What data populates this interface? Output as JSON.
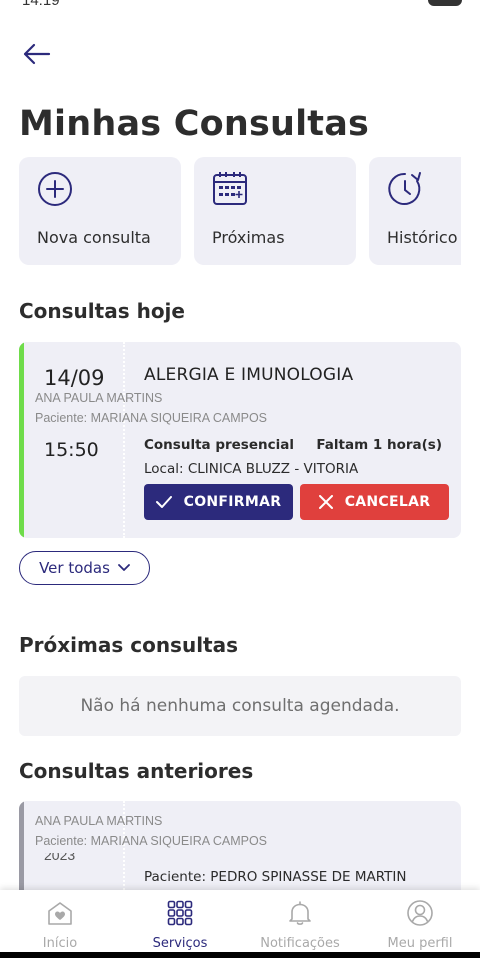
{
  "status_bar": {
    "time": "14:19",
    "battery": "85"
  },
  "header": {
    "title": "Minhas Consultas"
  },
  "quick_actions": [
    {
      "label": "Nova consulta",
      "icon": "plus-circle-icon"
    },
    {
      "label": "Próximas",
      "icon": "calendar-icon"
    },
    {
      "label": "Histórico",
      "icon": "history-clock-icon"
    }
  ],
  "today": {
    "section_title": "Consultas hoje",
    "appointment": {
      "date": "14/09",
      "specialty": "ALERGIA E IMUNOLOGIA",
      "doctor": "ANA PAULA MARTINS",
      "patient": "Paciente: MARIANA SIQUEIRA CAMPOS",
      "time": "15:50",
      "type": "Consulta presencial",
      "remaining": "Faltam 1 hora(s)",
      "location": "Local: CLINICA BLUZZ - VITORIA",
      "confirm_label": "CONFIRMAR",
      "cancel_label": "CANCELAR",
      "accent_color": "#6fdc4a"
    },
    "see_all_label": "Ver todas"
  },
  "upcoming": {
    "section_title": "Próximas consultas",
    "empty_message": "Não há nenhuma consulta agendada."
  },
  "previous": {
    "section_title": "Consultas anteriores",
    "appointment": {
      "doctor": "ANA PAULA MARTINS",
      "patient": "Paciente: MARIANA SIQUEIRA CAMPOS",
      "year": "2023",
      "patient_secondary": "Paciente: PEDRO SPINASSE DE MARTIN"
    }
  },
  "bottom_nav": [
    {
      "label": "Início",
      "icon": "home-heart-icon",
      "active": false
    },
    {
      "label": "Serviços",
      "icon": "grid-icon",
      "active": true
    },
    {
      "label": "Notificações",
      "icon": "bell-icon",
      "active": false
    },
    {
      "label": "Meu perfil",
      "icon": "user-icon",
      "active": false
    }
  ],
  "colors": {
    "primary": "#2c2a7c",
    "danger": "#e0403d",
    "success": "#6fdc4a",
    "card_bg": "#efeff6"
  }
}
